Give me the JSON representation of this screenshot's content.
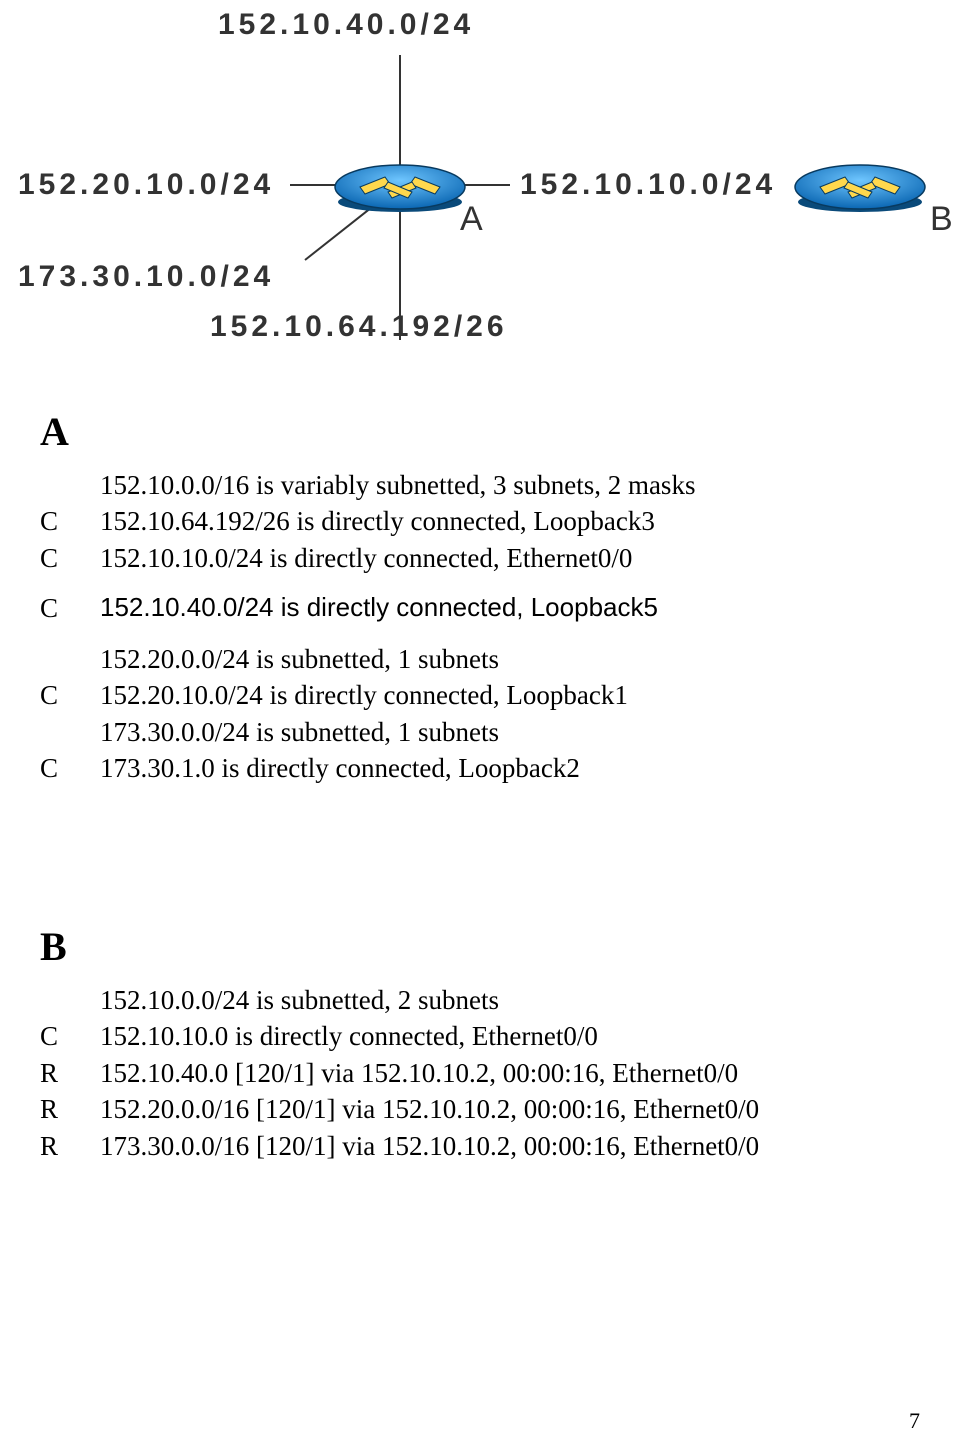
{
  "diagram": {
    "labels": {
      "top": "152.10.40.0/24",
      "left1": "152.20.10.0/24",
      "mid": "152.10.10.0/24",
      "left2": "173.30.10.0/24",
      "bottom": "152.10.64.192/26",
      "deviceA": "A",
      "deviceB": "B"
    }
  },
  "routerA": {
    "title": "A",
    "lines": [
      {
        "code": "",
        "text": "152.10.0.0/16 is variably subnetted, 3 subnets, 2 masks",
        "cls": "route-indent"
      },
      {
        "code": "C",
        "text": "152.10.64.192/26 is directly connected, Loopback3"
      },
      {
        "code": "C",
        "text": "152.10.10.0/24 is directly connected, Ethernet0/0"
      }
    ],
    "block2": [
      {
        "code": "C",
        "text": "152.10.40.0/24 is directly connected, Loopback5",
        "cls": "helv"
      }
    ],
    "block3": [
      {
        "code": "",
        "text": "152.20.0.0/24 is subnetted, 1 subnets",
        "cls": "route-indent"
      },
      {
        "code": "C",
        "text": "152.20.10.0/24 is directly connected, Loopback1"
      },
      {
        "code": "",
        "text": "173.30.0.0/24 is subnetted, 1 subnets",
        "cls": "route-indent"
      },
      {
        "code": "C",
        "text": "173.30.1.0 is directly connected, Loopback2"
      }
    ]
  },
  "routerB": {
    "title": "B",
    "lines": [
      {
        "code": "",
        "text": "152.10.0.0/24 is subnetted, 2 subnets",
        "cls": "route-indent"
      },
      {
        "code": "C",
        "text": "152.10.10.0   is directly connected, Ethernet0/0"
      },
      {
        "code": "R",
        "text": "152.10.40.0   [120/1] via 152.10.10.2, 00:00:16, Ethernet0/0"
      },
      {
        "code": "R",
        "text": "152.20.0.0/16 [120/1] via 152.10.10.2, 00:00:16, Ethernet0/0"
      },
      {
        "code": "R",
        "text": "173.30.0.0/16 [120/1] via 152.10.10.2, 00:00:16, Ethernet0/0"
      }
    ]
  },
  "pagenum": "7"
}
